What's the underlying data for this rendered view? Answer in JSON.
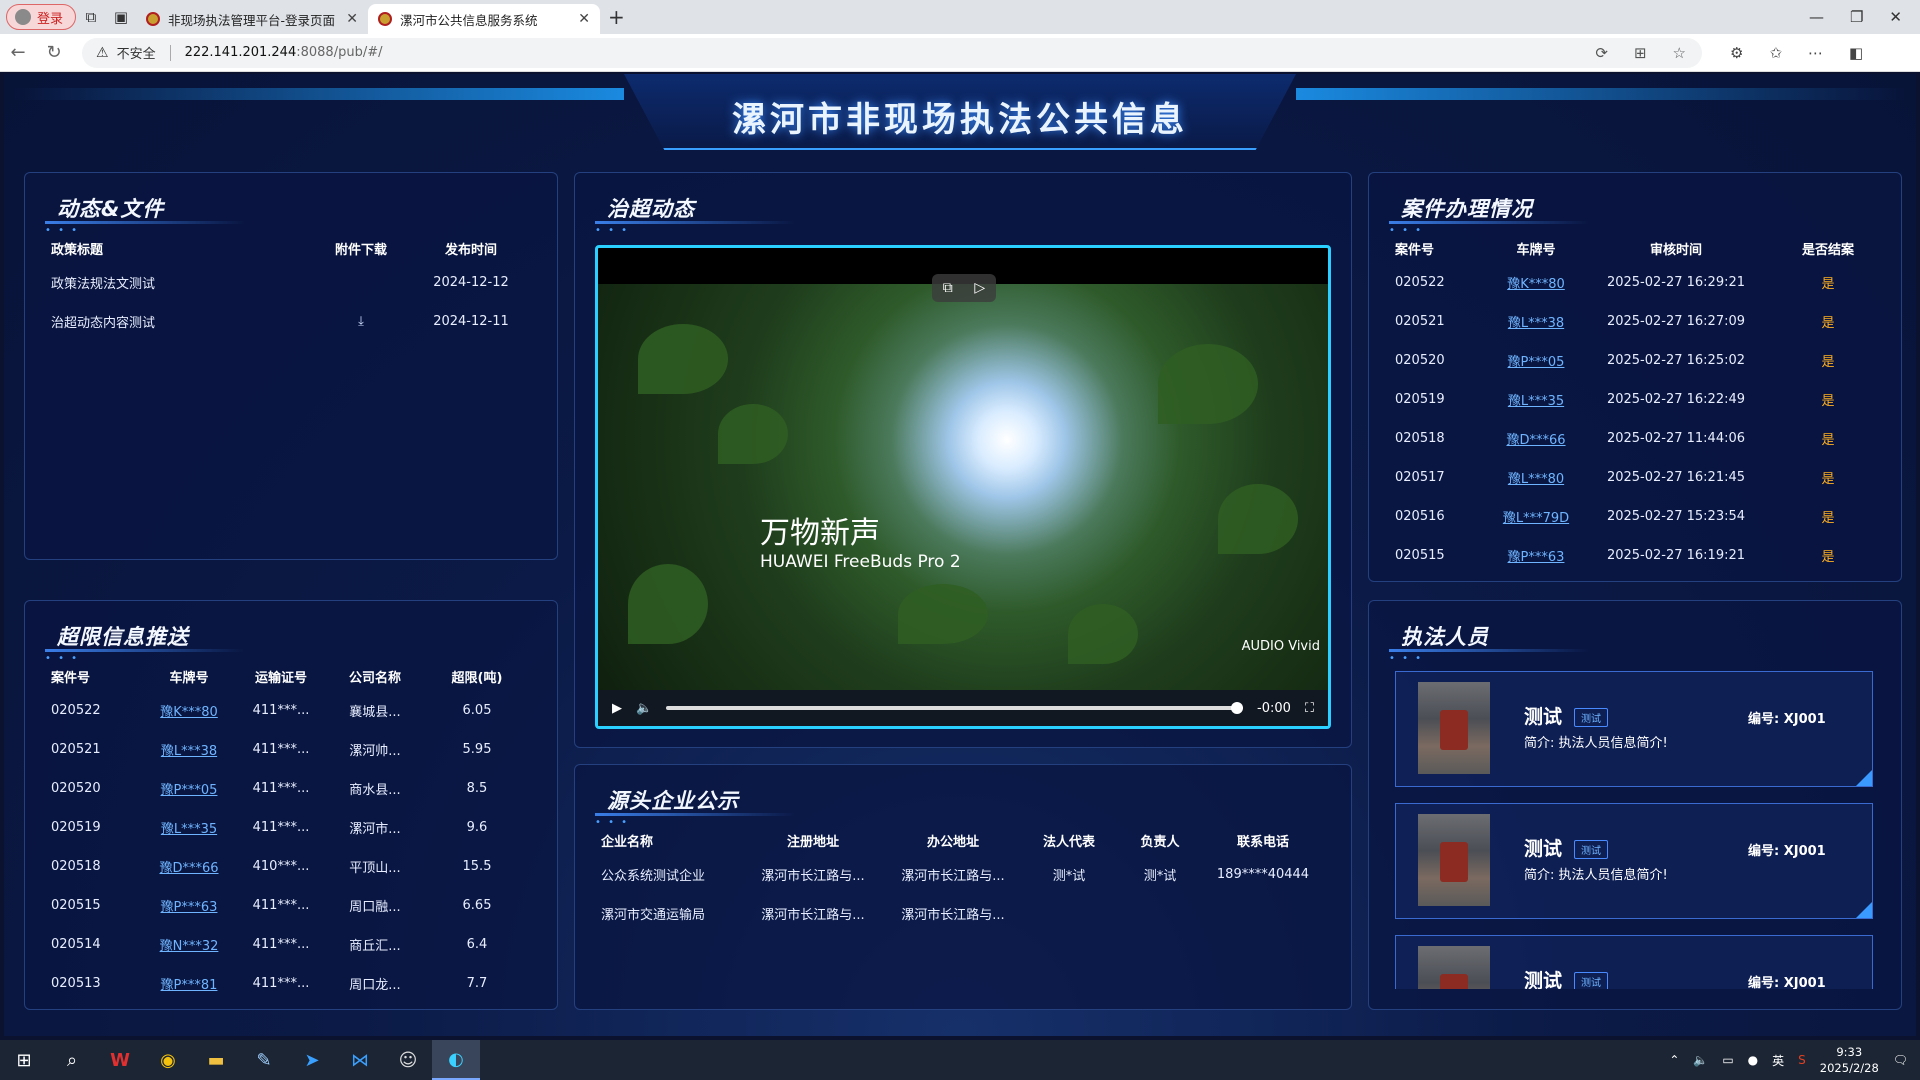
{
  "browser": {
    "profile_label": "登录",
    "tabs": [
      {
        "title": "非现场执法管理平台-登录页面"
      },
      {
        "title": "漯河市公共信息服务系统"
      }
    ],
    "security_label": "不安全",
    "url_host": "222.141.201.244",
    "url_rest": ":8088/pub/#/"
  },
  "page": {
    "title": "漯河市非现场执法公共信息"
  },
  "docs": {
    "title": "动态&文件",
    "headers": [
      "政策标题",
      "附件下载",
      "发布时间"
    ],
    "rows": [
      {
        "title": "政策法规法文测试",
        "download": "",
        "date": "2024-12-12"
      },
      {
        "title": "治超动态内容测试",
        "download": "⤓",
        "date": "2024-12-11"
      }
    ]
  },
  "video": {
    "title": "治超动态",
    "caption1": "万物新声",
    "caption2": "HUAWEI FreeBuds Pro 2",
    "brand": "AUDIO Vivid",
    "time": "-0:00",
    "progress": 1.0
  },
  "overlimit": {
    "title": "超限信息推送",
    "headers": [
      "案件号",
      "车牌号",
      "运输证号",
      "公司名称",
      "超限(吨)"
    ],
    "rows": [
      {
        "case": "020522",
        "plate": "豫K***80",
        "cert": "411***...",
        "company": "襄城县...",
        "over": "6.05"
      },
      {
        "case": "020521",
        "plate": "豫L***38",
        "cert": "411***...",
        "company": "漯河帅...",
        "over": "5.95"
      },
      {
        "case": "020520",
        "plate": "豫P***05",
        "cert": "411***...",
        "company": "商水县...",
        "over": "8.5"
      },
      {
        "case": "020519",
        "plate": "豫L***35",
        "cert": "411***...",
        "company": "漯河市...",
        "over": "9.6"
      },
      {
        "case": "020518",
        "plate": "豫D***66",
        "cert": "410***...",
        "company": "平顶山...",
        "over": "15.5"
      },
      {
        "case": "020515",
        "plate": "豫P***63",
        "cert": "411***...",
        "company": "周口融...",
        "over": "6.65"
      },
      {
        "case": "020514",
        "plate": "豫N***32",
        "cert": "411***...",
        "company": "商丘汇...",
        "over": "6.4"
      },
      {
        "case": "020513",
        "plate": "豫P***81",
        "cert": "411***...",
        "company": "周口龙...",
        "over": "7.7"
      }
    ]
  },
  "cases": {
    "title": "案件办理情况",
    "headers": [
      "案件号",
      "车牌号",
      "审核时间",
      "是否结案"
    ],
    "rows": [
      {
        "case": "020522",
        "plate": "豫K***80",
        "time": "2025-02-27 16:29:21",
        "closed": "是"
      },
      {
        "case": "020521",
        "plate": "豫L***38",
        "time": "2025-02-27 16:27:09",
        "closed": "是"
      },
      {
        "case": "020520",
        "plate": "豫P***05",
        "time": "2025-02-27 16:25:02",
        "closed": "是"
      },
      {
        "case": "020519",
        "plate": "豫L***35",
        "time": "2025-02-27 16:22:49",
        "closed": "是"
      },
      {
        "case": "020518",
        "plate": "豫D***66",
        "time": "2025-02-27 11:44:06",
        "closed": "是"
      },
      {
        "case": "020517",
        "plate": "豫L***80",
        "time": "2025-02-27 16:21:45",
        "closed": "是"
      },
      {
        "case": "020516",
        "plate": "豫L***79D",
        "time": "2025-02-27 15:23:54",
        "closed": "是"
      },
      {
        "case": "020515",
        "plate": "豫P***63",
        "time": "2025-02-27 16:19:21",
        "closed": "是"
      }
    ]
  },
  "enterprise": {
    "title": "源头企业公示",
    "headers": [
      "企业名称",
      "注册地址",
      "办公地址",
      "法人代表",
      "负责人",
      "联系电话"
    ],
    "rows": [
      {
        "name": "公众系统测试企业",
        "reg": "漯河市长江路与...",
        "office": "漯河市长江路与...",
        "legal": "测*试",
        "manager": "测*试",
        "phone": "189****40444"
      },
      {
        "name": "漯河市交通运输局",
        "reg": "漯河市长江路与...",
        "office": "漯河市长江路与...",
        "legal": "",
        "manager": "",
        "phone": ""
      }
    ]
  },
  "staff": {
    "title": "执法人员",
    "items": [
      {
        "name": "测试",
        "tag": "测试",
        "no": "编号: XJ001",
        "intro": "简介: 执法人员信息简介!"
      },
      {
        "name": "测试",
        "tag": "测试",
        "no": "编号: XJ001",
        "intro": "简介: 执法人员信息简介!"
      },
      {
        "name": "测试",
        "tag": "测试",
        "no": "编号: XJ001",
        "intro": ""
      }
    ]
  },
  "taskbar": {
    "ime": "英",
    "time": "9:33",
    "date": "2025/2/28"
  }
}
